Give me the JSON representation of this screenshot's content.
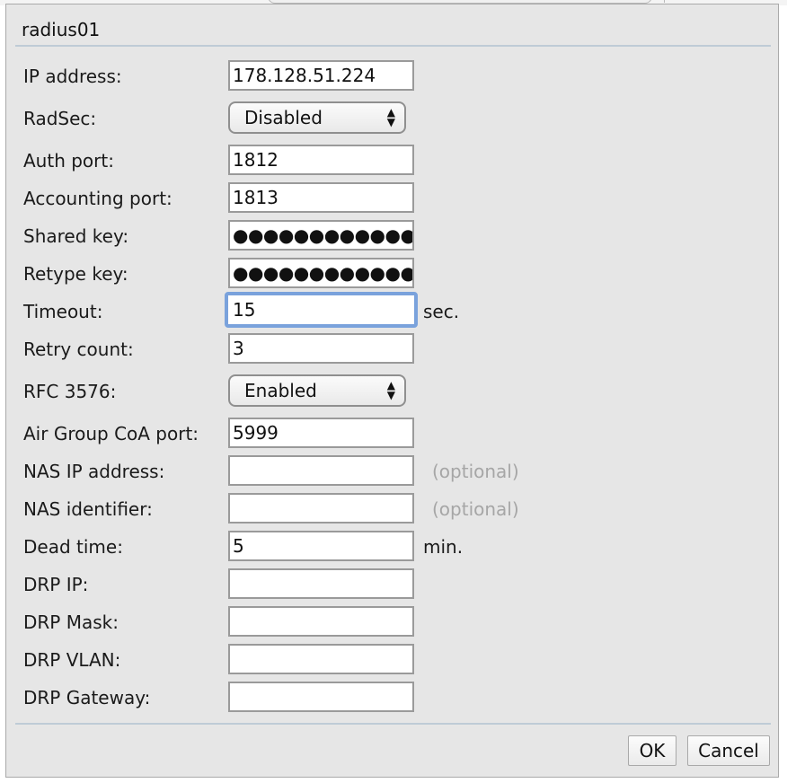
{
  "dialog": {
    "title": "radius01",
    "fields": {
      "ip_address": {
        "label": "IP address:",
        "value": "178.128.51.224"
      },
      "radsec": {
        "label": "RadSec:",
        "value": "Disabled"
      },
      "auth_port": {
        "label": "Auth port:",
        "value": "1812"
      },
      "accounting_port": {
        "label": "Accounting port:",
        "value": "1813"
      },
      "shared_key": {
        "label": "Shared key:",
        "value": "●●●●●●●●●●●●●●●●●●"
      },
      "retype_key": {
        "label": "Retype key:",
        "value": "●●●●●●●●●●●●●●●●●●"
      },
      "timeout": {
        "label": "Timeout:",
        "value": "15",
        "suffix": "sec."
      },
      "retry_count": {
        "label": "Retry count:",
        "value": "3"
      },
      "rfc3576": {
        "label": "RFC 3576:",
        "value": "Enabled"
      },
      "air_group_coa_port": {
        "label": "Air Group CoA port:",
        "value": "5999"
      },
      "nas_ip_address": {
        "label": "NAS IP address:",
        "value": "",
        "hint": "(optional)"
      },
      "nas_identifier": {
        "label": "NAS identifier:",
        "value": "",
        "hint": "(optional)"
      },
      "dead_time": {
        "label": "Dead time:",
        "value": "5",
        "suffix": "min."
      },
      "drp_ip": {
        "label": "DRP IP:",
        "value": ""
      },
      "drp_mask": {
        "label": "DRP Mask:",
        "value": ""
      },
      "drp_vlan": {
        "label": "DRP VLAN:",
        "value": ""
      },
      "drp_gateway": {
        "label": "DRP Gateway:",
        "value": ""
      }
    },
    "buttons": {
      "ok": "OK",
      "cancel": "Cancel"
    }
  },
  "colors": {
    "dialog_background": "#e6e6e6",
    "focus_ring": "#7aa2dc",
    "optional_hint": "#a6a6a6"
  },
  "icons": {
    "select_arrows": "up-down-arrows-icon"
  }
}
